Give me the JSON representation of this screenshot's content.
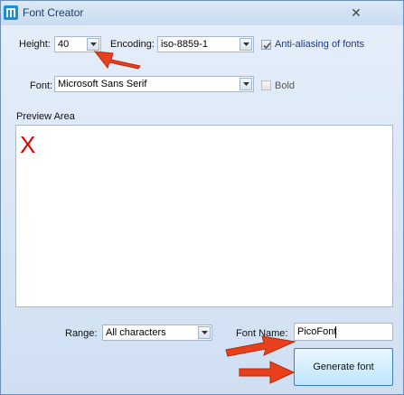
{
  "window": {
    "title": "Font Creator",
    "close_glyph": "✕",
    "icon": "app-icon"
  },
  "settings": {
    "height_label": "Height:",
    "height_value": "40",
    "encoding_label": "Encoding:",
    "encoding_value": "iso-8859-1",
    "antialias_label": "Anti-aliasing of fonts",
    "antialias_checked": true,
    "font_label": "Font:",
    "font_value": "Microsoft Sans Serif",
    "bold_label": "Bold",
    "bold_checked": false
  },
  "preview": {
    "label": "Preview Area",
    "glyph": "X",
    "glyph_color": "#e30000"
  },
  "bottom": {
    "range_label": "Range:",
    "range_value": "All characters",
    "font_name_label": "Font Name:",
    "font_name_value": "PicoFont",
    "generate_label": "Generate font"
  },
  "colors": {
    "annotation_arrow": "#e8401c",
    "button_border": "#3c7fb1"
  }
}
